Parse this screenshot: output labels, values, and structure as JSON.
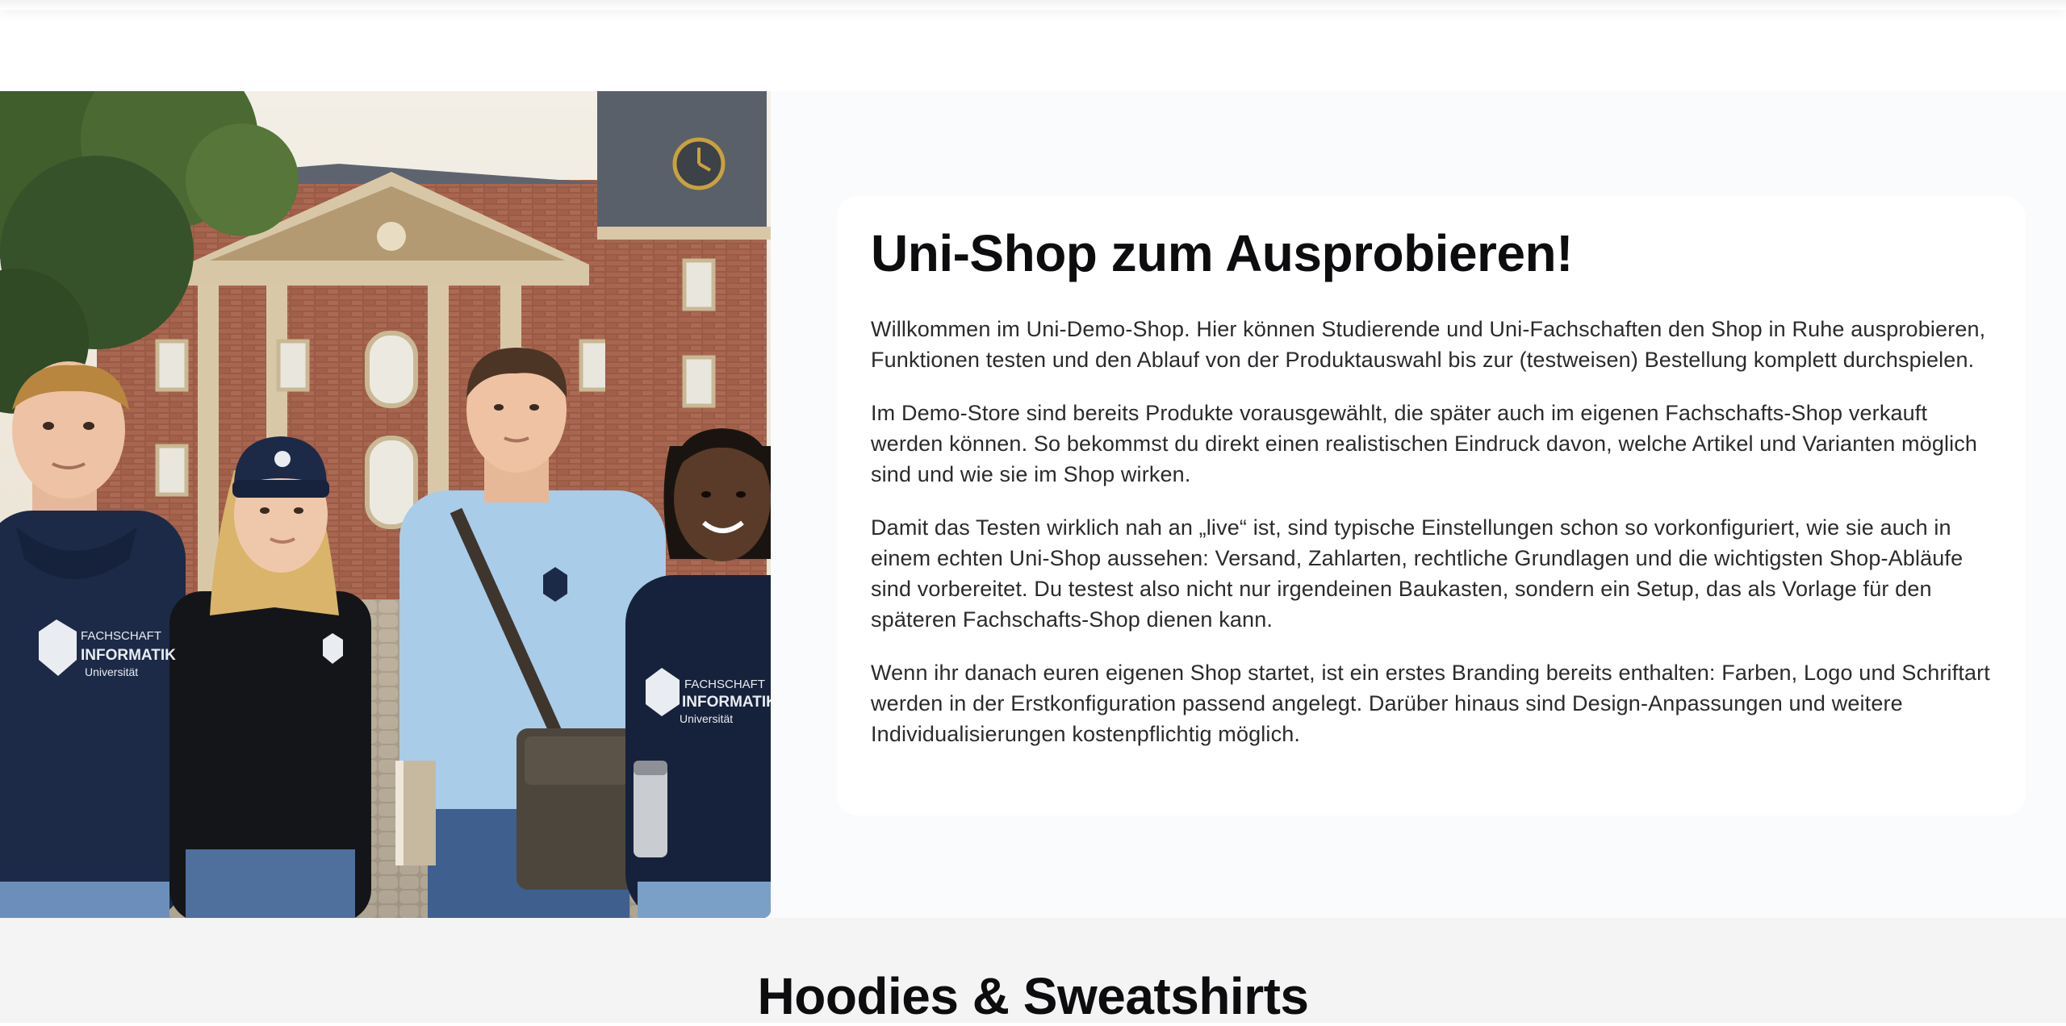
{
  "hero": {
    "image_alt": "Studierende in Fachschaft-Informatik-Merch vor einem Universitätsgebäude",
    "merch_print": {
      "line1": "FACHSCHAFT",
      "line2": "INFORMATIK",
      "line3": "Universität"
    },
    "title": "Uni-Shop zum Ausprobieren!",
    "paragraphs": [
      "Willkommen im Uni-Demo-Shop. Hier können Studierende und Uni-Fachschaften den Shop in Ruhe ausprobieren, Funktionen testen und den Ablauf von der Produktauswahl bis zur (testweisen) Bestellung komplett durchspielen.",
      "Im Demo-Store sind bereits Produkte vorausgewählt, die später auch im eigenen Fachschafts-Shop verkauft werden können. So bekommst du direkt einen realistischen Eindruck davon, welche Artikel und Varianten möglich sind und wie sie im Shop wirken.",
      "Damit das Testen wirklich nah an „live“ ist, sind typische Einstellungen schon so vorkonfiguriert, wie sie auch in einem echten Uni-Shop aussehen: Versand, Zahlarten, rechtliche Grundlagen und die wichtigsten Shop-Abläufe sind vorbereitet. Du testest also nicht nur irgendeinen Baukasten, sondern ein Setup, das als Vorlage für den späteren Fachschafts-Shop dienen kann.",
      "Wenn ihr danach euren eigenen Shop startet, ist ein erstes Branding bereits enthalten: Farben, Logo und Schriftart werden in der Erstkonfiguration passend angelegt. Darüber hinaus sind Design-Anpassungen und weitere Individualisierungen kostenpflichtig möglich."
    ]
  },
  "section": {
    "heading": "Hoodies & Sweatshirts"
  },
  "colors": {
    "hero_bg": "#fafbfc",
    "card_bg": "#ffffff",
    "section_bg": "#f4f4f5",
    "navy": "#1c2a48",
    "light_blue": "#a9cce8"
  }
}
